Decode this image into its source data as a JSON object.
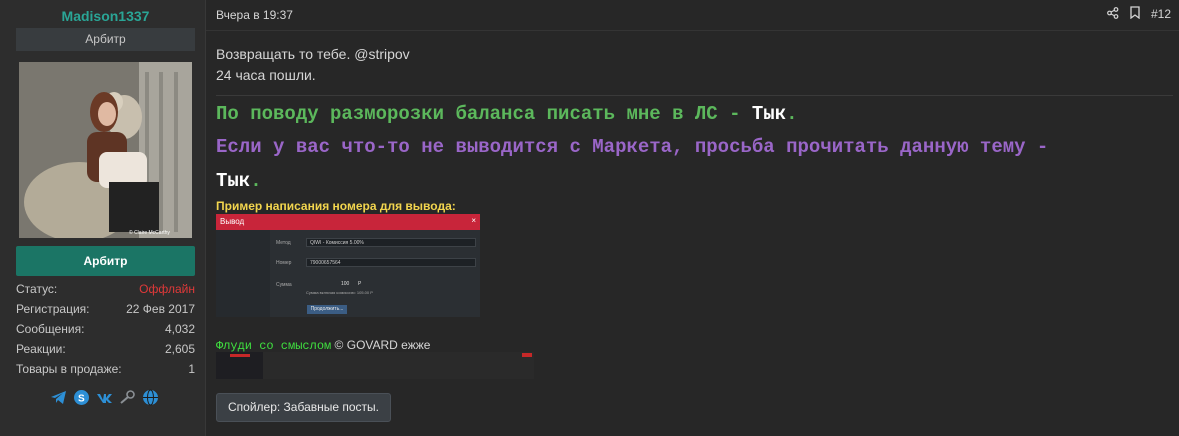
{
  "user": {
    "username": "Madison1337",
    "title": "Арбитр",
    "role_button": "Арбитр",
    "stats": [
      {
        "label": "Статус:",
        "value": "Оффлайн"
      },
      {
        "label": "Регистрация:",
        "value": "22 Фев 2017"
      },
      {
        "label": "Сообщения:",
        "value": "4,032"
      },
      {
        "label": "Реакции:",
        "value": "2,605"
      },
      {
        "label": "Товары в продаже:",
        "value": "1"
      }
    ],
    "avatar_caption": "© Claire McCarthy",
    "socials": [
      "telegram-icon",
      "skype-icon",
      "vk-icon",
      "steam-icon",
      "web-icon"
    ]
  },
  "post": {
    "date": "Вчера в 19:37",
    "number": "#12",
    "line1": "Возвращать то тебе. @stripov",
    "line2": "24 часа пошли.",
    "big1_text": "По поводу разморозки баланса писать мне в ЛС - ",
    "big1_link": "Тык",
    "big2_text": "Если у вас что-то не выводится с Маркета, просьба прочитать данную тему -",
    "big3_link": "Тык",
    "dot": ".",
    "example_label": "Пример написания номера для вывода:",
    "flood_green": "Флуди со смыслом",
    "flood_rest": " © GOVARD ежже",
    "spoiler": "Спойлер: Забавные посты."
  },
  "screenshot": {
    "title": "Вывод",
    "close": "×",
    "method_label": "Метод",
    "method_value": "QIWI - Комиссия 5.00%",
    "number_label": "Номер",
    "number_value": "79000657564",
    "sum_label": "Сумма",
    "sum_value": "100",
    "currency": "Р",
    "sum_note": "Сумма включая комиссию: 105.00 Р",
    "submit": "Продолжить..."
  },
  "colors": {
    "accent": "#2aa596",
    "role_button": "#1b7565",
    "offline": "#e03939",
    "green_text": "#5cb85c",
    "purple_text": "#9a66c8",
    "example_label": "#f2d54e"
  }
}
